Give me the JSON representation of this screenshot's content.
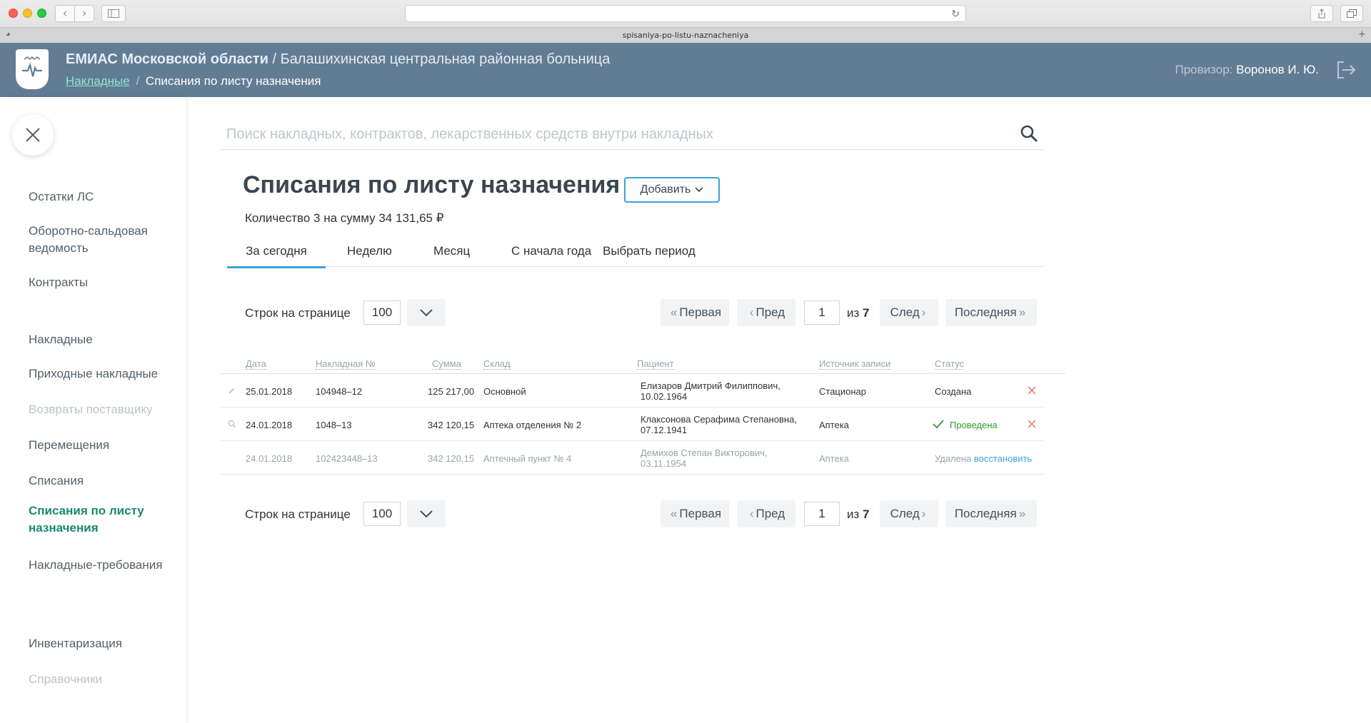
{
  "browser": {
    "tab_title": "spisaniya-po-listu-naznacheniya"
  },
  "header": {
    "org_name": "ЕМИАС Московской области",
    "separator": "/",
    "hospital": "Балашихинская центральная районная больница",
    "breadcrumb_link": "Накладные",
    "breadcrumb_sep": "/",
    "breadcrumb_current": "Списания по листу назначения",
    "user_role": "Провизор:",
    "user_name": "Воронов  И. Ю."
  },
  "sidebar": {
    "items": [
      {
        "label": "Остатки ЛС",
        "state": "normal"
      },
      {
        "label": "Оборотно-сальдовая ведомость",
        "state": "normal"
      },
      {
        "label": "Контракты",
        "state": "normal"
      },
      {
        "label": "Накладные",
        "state": "normal"
      },
      {
        "label": "Приходные накладные",
        "state": "normal"
      },
      {
        "label": "Возвраты поставщику",
        "state": "disabled"
      },
      {
        "label": "Перемещения",
        "state": "normal"
      },
      {
        "label": "Списания",
        "state": "normal"
      },
      {
        "label": "Списания по листу назначения",
        "state": "active"
      },
      {
        "label": "Накладные-требования",
        "state": "normal"
      },
      {
        "label": "Инвентаризация",
        "state": "normal"
      },
      {
        "label": "Справочники",
        "state": "disabled"
      }
    ]
  },
  "search": {
    "placeholder": "Поиск накладных, контрактов, лекарственных средств внутри накладных",
    "value": ""
  },
  "page": {
    "title": "Списания по листу назначения",
    "add_button": "Добавить",
    "summary": "Количество 3 на сумму 34 131,65 ₽"
  },
  "tabs": [
    {
      "label": "За сегодня",
      "active": true
    },
    {
      "label": "Неделю",
      "active": false
    },
    {
      "label": "Месяц",
      "active": false
    },
    {
      "label": "С начала года",
      "active": false
    },
    {
      "label": "Выбрать период",
      "active": false
    }
  ],
  "pager": {
    "rows_label": "Строк на странице",
    "rows_value": "100",
    "first": "Первая",
    "prev": "Пред",
    "page_value": "1",
    "of_label": "из",
    "total_pages": "7",
    "next": "След",
    "last": "Последняя"
  },
  "table": {
    "columns": [
      "Дата",
      "Накладная №",
      "Сумма",
      "Склад",
      "Пациент",
      "Источник записи",
      "Статус"
    ],
    "rows": [
      {
        "date": "25.01.2018",
        "number": "104948–12",
        "sum": "125 217,00",
        "warehouse": "Основной",
        "patient_name": "Елизаров Дмитрий Филиппович,",
        "patient_dob": "10.02.1964",
        "source": "Стационар",
        "status": "Создана",
        "status_kind": "created",
        "icon": "pencil-icon"
      },
      {
        "date": "24.01.2018",
        "number": "1048–13",
        "sum": "342 120,15",
        "warehouse": "Аптека отделения № 2",
        "patient_name": "Клаксонова Серафима Степановна,",
        "patient_dob": "07.12.1941",
        "source": "Аптека",
        "status": "Проведена",
        "status_kind": "done",
        "icon": "magnifier-icon"
      },
      {
        "date": "24.01.2018",
        "number": "102423448–13",
        "sum": "342 120,15",
        "warehouse": "Аптечный пункт № 4",
        "patient_name": "Демихов Степан Викторович,",
        "patient_dob": "03.11.1954",
        "source": "Аптека",
        "status": "Удалена",
        "status_kind": "deleted",
        "restore": "восстановить"
      }
    ]
  },
  "colors": {
    "header_bg": "#627c94",
    "accent_blue": "#3aa3d8",
    "active_green": "#1a8a6c",
    "done_green": "#2e9a2e",
    "delete_red": "#e57373"
  }
}
